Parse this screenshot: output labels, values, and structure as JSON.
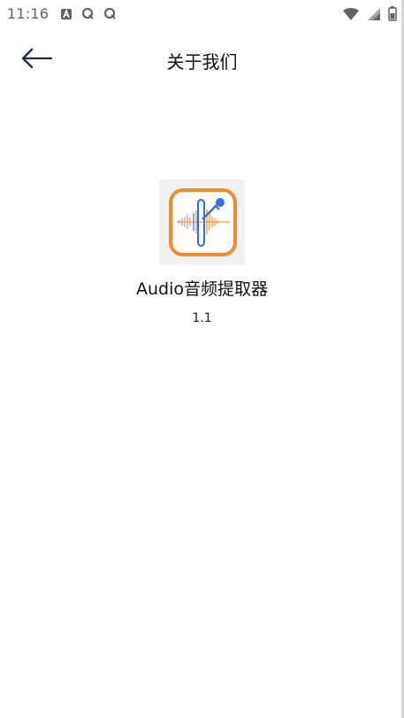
{
  "status_bar": {
    "time": "11:16",
    "left_icons": [
      "a-notification-icon",
      "q-notification-icon",
      "q-notification-icon"
    ],
    "right_icons": [
      "wifi-icon",
      "signal-icon",
      "battery-icon"
    ]
  },
  "app_bar": {
    "back_icon": "back-arrow-icon",
    "title": "关于我们"
  },
  "about": {
    "app_icon": "audio-extractor-app-icon",
    "app_name": "Audio音频提取器",
    "version": "1.1"
  },
  "colors": {
    "background": "#ffffff",
    "text": "#111111",
    "status_text": "#5f6368",
    "icon_orange": "#f28a2e",
    "icon_blue": "#2f6fe4"
  }
}
